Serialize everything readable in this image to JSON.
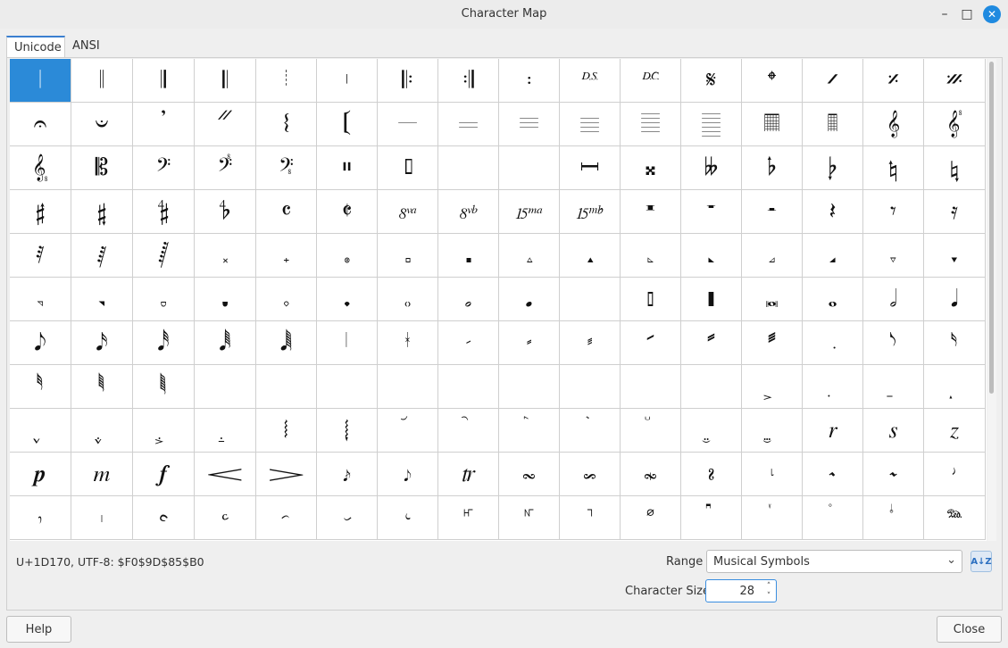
{
  "window": {
    "title": "Character Map"
  },
  "tabs": [
    {
      "label": "Unicode",
      "active": true
    },
    {
      "label": "ANSI",
      "active": false
    }
  ],
  "grid": {
    "selected_index": 0,
    "cells": [
      "𝄀",
      "𝄁",
      "𝄂",
      "𝄃",
      "𝄄",
      "𝄅",
      "𝄆",
      "𝄇",
      "𝄈",
      "𝄉",
      "𝄊",
      "𝄋",
      "𝄌",
      "𝄍",
      "𝄎",
      "𝄏",
      "𝄐",
      "𝄑",
      "𝄒",
      "𝄓",
      "𝄔",
      "𝄕",
      "𝄖",
      "𝄗",
      "𝄘",
      "𝄙",
      "𝄚",
      "𝄛",
      "𝄜",
      "𝄝",
      "𝄞",
      "𝄟",
      "𝄠",
      "𝄡",
      "𝄢",
      "𝄣",
      "𝄤",
      "𝄥",
      "𝄦",
      "𝄧",
      "𝄨",
      "𝄩",
      "𝄪",
      "𝄫",
      "𝄬",
      "𝄭",
      "𝄮",
      "𝄯",
      "𝄰",
      "𝄱",
      "𝄲",
      "𝄳",
      "𝄴",
      "𝄵",
      "𝄶",
      "𝄷",
      "𝄸",
      "𝄹",
      "𝄺",
      "𝄻",
      "𝄼",
      "𝄽",
      "𝄾",
      "𝄿",
      "𝅀",
      "𝅁",
      "𝅂",
      "𝅃",
      "𝅄",
      "𝅅",
      "𝅆",
      "𝅇",
      "𝅈",
      "𝅉",
      "𝅊",
      "𝅋",
      "𝅌",
      "𝅍",
      "𝅎",
      "𝅏",
      "𝅐",
      "𝅑",
      "𝅒",
      "𝅓",
      "𝅔",
      "𝅕",
      "𝅖",
      "𝅗",
      "𝅘",
      "𝅙",
      "𝅚",
      "𝅛",
      "𝅜",
      "𝅝",
      "𝅗𝅥",
      "𝅘𝅥",
      "𝅘𝅥𝅮",
      "𝅘𝅥𝅯",
      "𝅘𝅥𝅰",
      "𝅘𝅥𝅱",
      "𝅘𝅥𝅲",
      "𝅥",
      "𝅦",
      "𝅧",
      "𝅨",
      "𝅩",
      "𝅪",
      "𝅫",
      "𝅬",
      "𝅭",
      "𝅮",
      "𝅯",
      "𝅰",
      "𝅱",
      "𝅲",
      "",
      "",
      "",
      "",
      "",
      "",
      "",
      "",
      "",
      "𝅻",
      "𝅼",
      "𝅽",
      "𝅾",
      "𝅿",
      "𝆀",
      "𝆁",
      "𝆂",
      "𝆃",
      "𝆄",
      "𝆅",
      "𝆆",
      "𝆇",
      "𝆈",
      "𝆉",
      "𝆊",
      "𝆋",
      "𝆌",
      "𝆍",
      "𝆎",
      "𝆏",
      "𝆐",
      "𝆑",
      "𝆒",
      "𝆓",
      "𝆔",
      "𝆕",
      "𝆖",
      "𝆗",
      "𝆘",
      "𝆙",
      "𝆚",
      "𝆛",
      "𝆜",
      "𝆝",
      "𝆞",
      "𝆟",
      "𝆠",
      "𝆡",
      "𝆢",
      "𝆣",
      "𝆤",
      "𝆥",
      "𝆦",
      "𝆧",
      "𝆨",
      "𝆩",
      "𝆪",
      "𝆫",
      "𝆬",
      "𝆭",
      "𝆮"
    ]
  },
  "status": {
    "text": "U+1D170, UTF-8: $F0$9D$85$B0"
  },
  "range": {
    "label": "Range",
    "value": "Musical Symbols"
  },
  "size": {
    "label": "Character Size",
    "value": "28"
  },
  "buttons": {
    "help": "Help",
    "close": "Close"
  },
  "icons": {
    "minimize": "minimize-icon",
    "maximize": "maximize-icon",
    "close": "close-icon",
    "sort": "sort-az-icon"
  },
  "colors": {
    "accent": "#2b8ad8",
    "close_button": "#1f8ae0"
  }
}
